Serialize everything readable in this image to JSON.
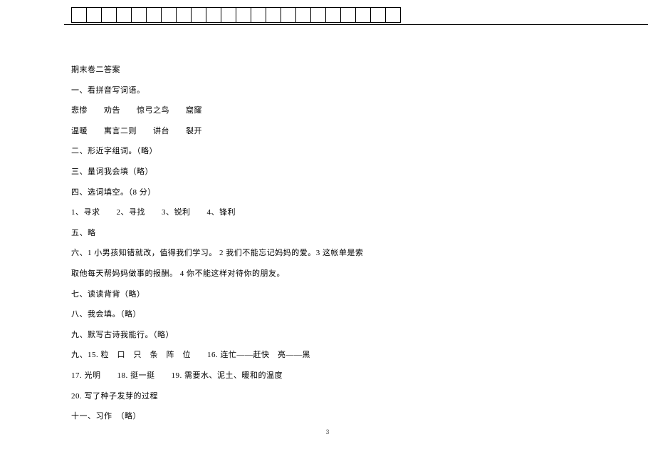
{
  "title": "期末卷二答案",
  "section1_label": "一、看拼音写词语。",
  "s1_line1": "悲惨　　劝告　　惊弓之鸟　　窟窿",
  "s1_line2": "温暖　　寓言二则　　讲台　　裂开",
  "section2": "二、形近字组词。（略）",
  "section3": "三、量词我会填（略）",
  "section4_label": "四、选词填空。（8 分）",
  "s4_line": "1、寻求　　2、寻找　　3、锐利　　4、锋利",
  "section5": "五、略",
  "section6_l1": "六、1 小男孩知错就改，值得我们学习。 2 我们不能忘记妈妈的爱。3 这帐单是索",
  "section6_l2": "取他每天帮妈妈做事的报酬。 4 你不能这样对待你的朋友。",
  "section7": "七、读读背背（略）",
  "section8": "八、我会填。（略）",
  "section9": "九、默写古诗我能行。（略）",
  "section9b_l1": "九、15. 粒　口　只　条　阵　位　　16. 连忙——赶快　亮——黑",
  "section9b_l2": "17. 光明　　18. 挺一挺　　19. 需要水、泥土、暖和的温度",
  "section9b_l3": "20. 写了种子发芽的过程",
  "section11": "十一、习作　（略）",
  "page_number": "3",
  "grid_cells": 22
}
